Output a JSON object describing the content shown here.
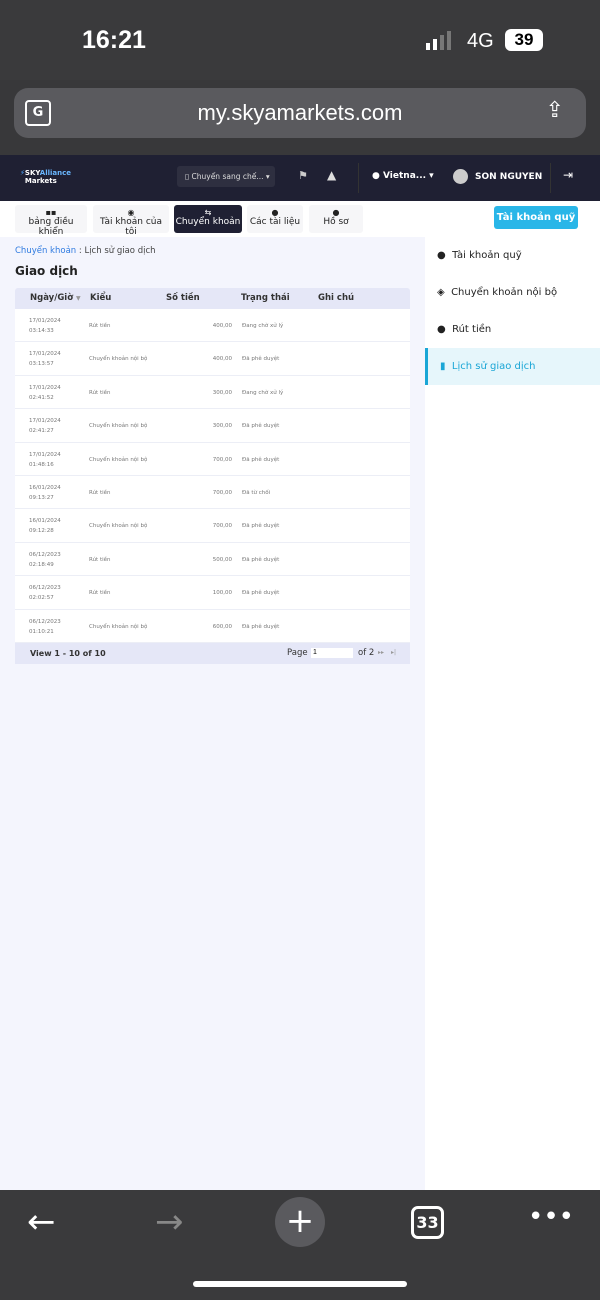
{
  "status_bar": {
    "time": "16:21",
    "network": "4G",
    "battery": "39"
  },
  "browser": {
    "url": "my.skyamarkets.com",
    "tab_count": "33"
  },
  "header": {
    "logo": "SKY Alliance Markets",
    "switch_label": "Chuyển sang chế...",
    "language": "Vietna...",
    "user": "SON NGUYEN"
  },
  "tabs": [
    {
      "label": "bảng điều khiển",
      "icon": "grid-icon"
    },
    {
      "label": "Tài khoản của tôi",
      "icon": "user-circle-icon"
    },
    {
      "label": "Chuyển khoản",
      "icon": "transfer-icon"
    },
    {
      "label": "Các tài liệu",
      "icon": "docs-icon"
    },
    {
      "label": "Hồ sơ",
      "icon": "person-icon"
    }
  ],
  "fund_button": "Tài khoản quỹ",
  "breadcrumb": {
    "link": "Chuyển khoản",
    "sep": " : ",
    "current": "Lịch sử giao dịch"
  },
  "page_title": "Giao dịch",
  "table": {
    "headers": [
      "Ngày/Giờ",
      "Kiểu",
      "Số tiền",
      "Trạng thái",
      "Ghi chú"
    ],
    "rows": [
      {
        "date": "17/01/2024",
        "time": "03:14:33",
        "type": "Rút tiền",
        "amount": "400,00",
        "status": "Đang chờ xử lý"
      },
      {
        "date": "17/01/2024",
        "time": "03:13:57",
        "type": "Chuyển khoản nội bộ",
        "amount": "400,00",
        "status": "Đã phê duyệt"
      },
      {
        "date": "17/01/2024",
        "time": "02:41:52",
        "type": "Rút tiền",
        "amount": "300,00",
        "status": "Đang chờ xử lý"
      },
      {
        "date": "17/01/2024",
        "time": "02:41:27",
        "type": "Chuyển khoản nội bộ",
        "amount": "300,00",
        "status": "Đã phê duyệt"
      },
      {
        "date": "17/01/2024",
        "time": "01:48:16",
        "type": "Chuyển khoản nội bộ",
        "amount": "700,00",
        "status": "Đã phê duyệt"
      },
      {
        "date": "16/01/2024",
        "time": "09:13:27",
        "type": "Rút tiền",
        "amount": "700,00",
        "status": "Đã từ chối"
      },
      {
        "date": "16/01/2024",
        "time": "09:12:28",
        "type": "Chuyển khoản nội bộ",
        "amount": "700,00",
        "status": "Đã phê duyệt"
      },
      {
        "date": "06/12/2023",
        "time": "02:18:49",
        "type": "Rút tiền",
        "amount": "500,00",
        "status": "Đã phê duyệt"
      },
      {
        "date": "06/12/2023",
        "time": "02:02:57",
        "type": "Rút tiền",
        "amount": "100,00",
        "status": "Đã phê duyệt"
      },
      {
        "date": "06/12/2023",
        "time": "01:10:21",
        "type": "Chuyển khoản nội bộ",
        "amount": "600,00",
        "status": "Đã phê duyệt"
      }
    ],
    "footer": {
      "view": "View 1 - 10 of 10",
      "page_label": "Page",
      "page_value": "1",
      "of": "of 2"
    }
  },
  "sidebar": [
    {
      "label": "Tài khoản quỹ"
    },
    {
      "label": "Chuyển khoản nội bộ"
    },
    {
      "label": "Rút tiền"
    },
    {
      "label": "Lịch sử giao dịch",
      "active": true
    }
  ]
}
